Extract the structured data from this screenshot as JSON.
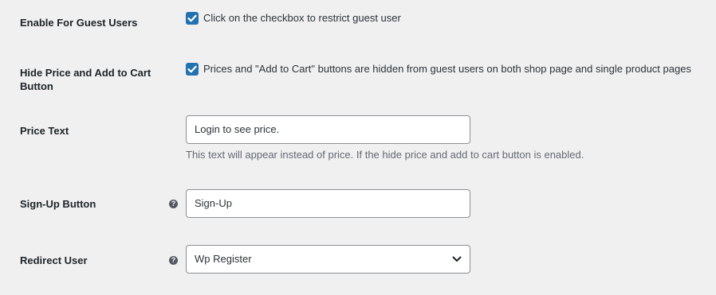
{
  "settings": {
    "guest": {
      "label": "Enable For Guest Users",
      "checked": true,
      "text": "Click on the checkbox to restrict guest user"
    },
    "hide_price": {
      "label_line1": "Hide Price and Add to Cart",
      "label_line2": "Button",
      "checked": true,
      "text": "Prices and \"Add to Cart\" buttons are hidden from guest users on both shop page and single product pages"
    },
    "price_text": {
      "label": "Price Text",
      "value": "Login to see price.",
      "description": "This text will appear instead of price. If the hide price and add to cart button is enabled."
    },
    "signup": {
      "label": "Sign-Up Button",
      "value": "Sign-Up",
      "help_icon": "question-circle-icon"
    },
    "redirect": {
      "label": "Redirect User",
      "selected": "Wp Register",
      "help_icon": "question-circle-icon"
    }
  },
  "colors": {
    "background": "#f0f0f1",
    "checkbox_accent": "#2271b1",
    "input_border": "#8c8f94"
  }
}
